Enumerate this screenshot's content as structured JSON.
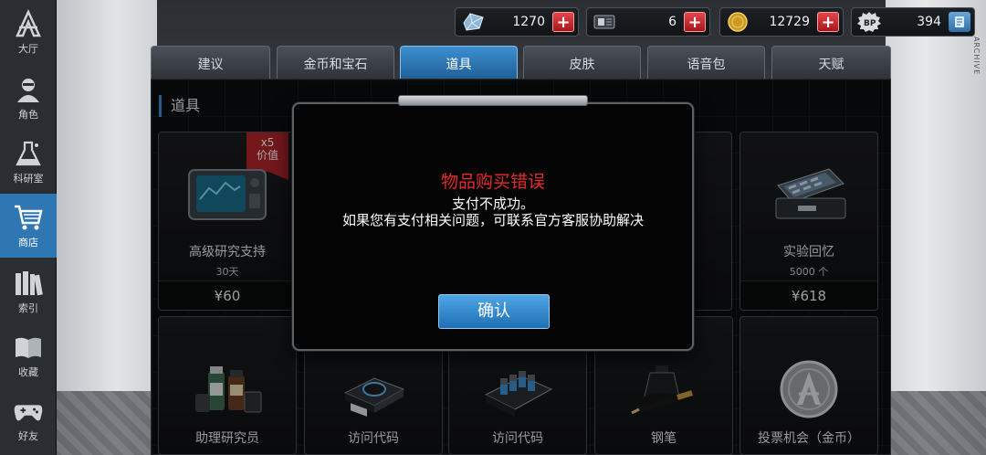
{
  "currencies": [
    {
      "icon": "crystal-icon",
      "value": "1270"
    },
    {
      "icon": "chip-icon",
      "value": "6"
    },
    {
      "icon": "gold-coin-icon",
      "value": "12729"
    },
    {
      "icon": "bp-icon",
      "value": "394"
    }
  ],
  "sidebar": {
    "items": [
      {
        "label": "大厅",
        "icon": "lobby-icon"
      },
      {
        "label": "角色",
        "icon": "character-icon"
      },
      {
        "label": "科研室",
        "icon": "lab-flask-icon"
      },
      {
        "label": "商店",
        "icon": "shopping-cart-icon"
      },
      {
        "label": "索引",
        "icon": "books-icon"
      },
      {
        "label": "收藏",
        "icon": "open-book-icon"
      },
      {
        "label": "好友",
        "icon": "gamepad-icon"
      }
    ]
  },
  "tabs": [
    {
      "label": "建议"
    },
    {
      "label": "金币和宝石"
    },
    {
      "label": "道具"
    },
    {
      "label": "皮肤"
    },
    {
      "label": "语音包"
    },
    {
      "label": "天赋"
    }
  ],
  "section_title": "道具",
  "cards": [
    {
      "name": "高级研究支持",
      "sub": "30天",
      "price": "¥60",
      "badge_line1": "x5",
      "badge_line2": "价值"
    },
    {
      "name": "实验回忆",
      "sub": "5000 个",
      "price": "¥618"
    },
    {
      "name": "助理研究员"
    },
    {
      "name": "访问代码"
    },
    {
      "name": "访问代码"
    },
    {
      "name": "钢笔"
    },
    {
      "name": "投票机会（金币）"
    }
  ],
  "modal": {
    "title": "物品购买错误",
    "line1": "支付不成功。",
    "line2": "如果您有支付相关问题，可联系官方客服协助解决",
    "confirm": "确认"
  },
  "side_text": "ARCHIVE",
  "colors": {
    "accent": "#2f77b3",
    "error": "#e32a2a",
    "plus": "#c8262b"
  }
}
